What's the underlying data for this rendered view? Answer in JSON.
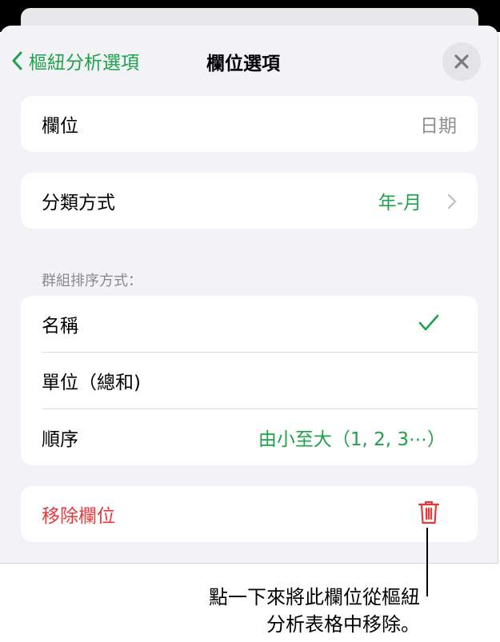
{
  "nav": {
    "back_label": "樞紐分析選項",
    "title": "欄位選項"
  },
  "field_row": {
    "label": "欄位",
    "value": "日期"
  },
  "group_by_row": {
    "label": "分類方式",
    "value": "年-月"
  },
  "sort_section": {
    "header": "群組排序方式：",
    "items": [
      {
        "label": "名稱",
        "checked": true
      },
      {
        "label": "單位（總和)"
      },
      {
        "label": "順序",
        "value": "由小至大（1, 2, 3⋯）"
      }
    ]
  },
  "remove_row": {
    "label": "移除欄位"
  },
  "callout": {
    "line1": "點一下來將此欄位從樞紐",
    "line2": "分析表格中移除。"
  },
  "colors": {
    "accent_green": "#1ea24a",
    "destructive_red": "#e6393a"
  }
}
